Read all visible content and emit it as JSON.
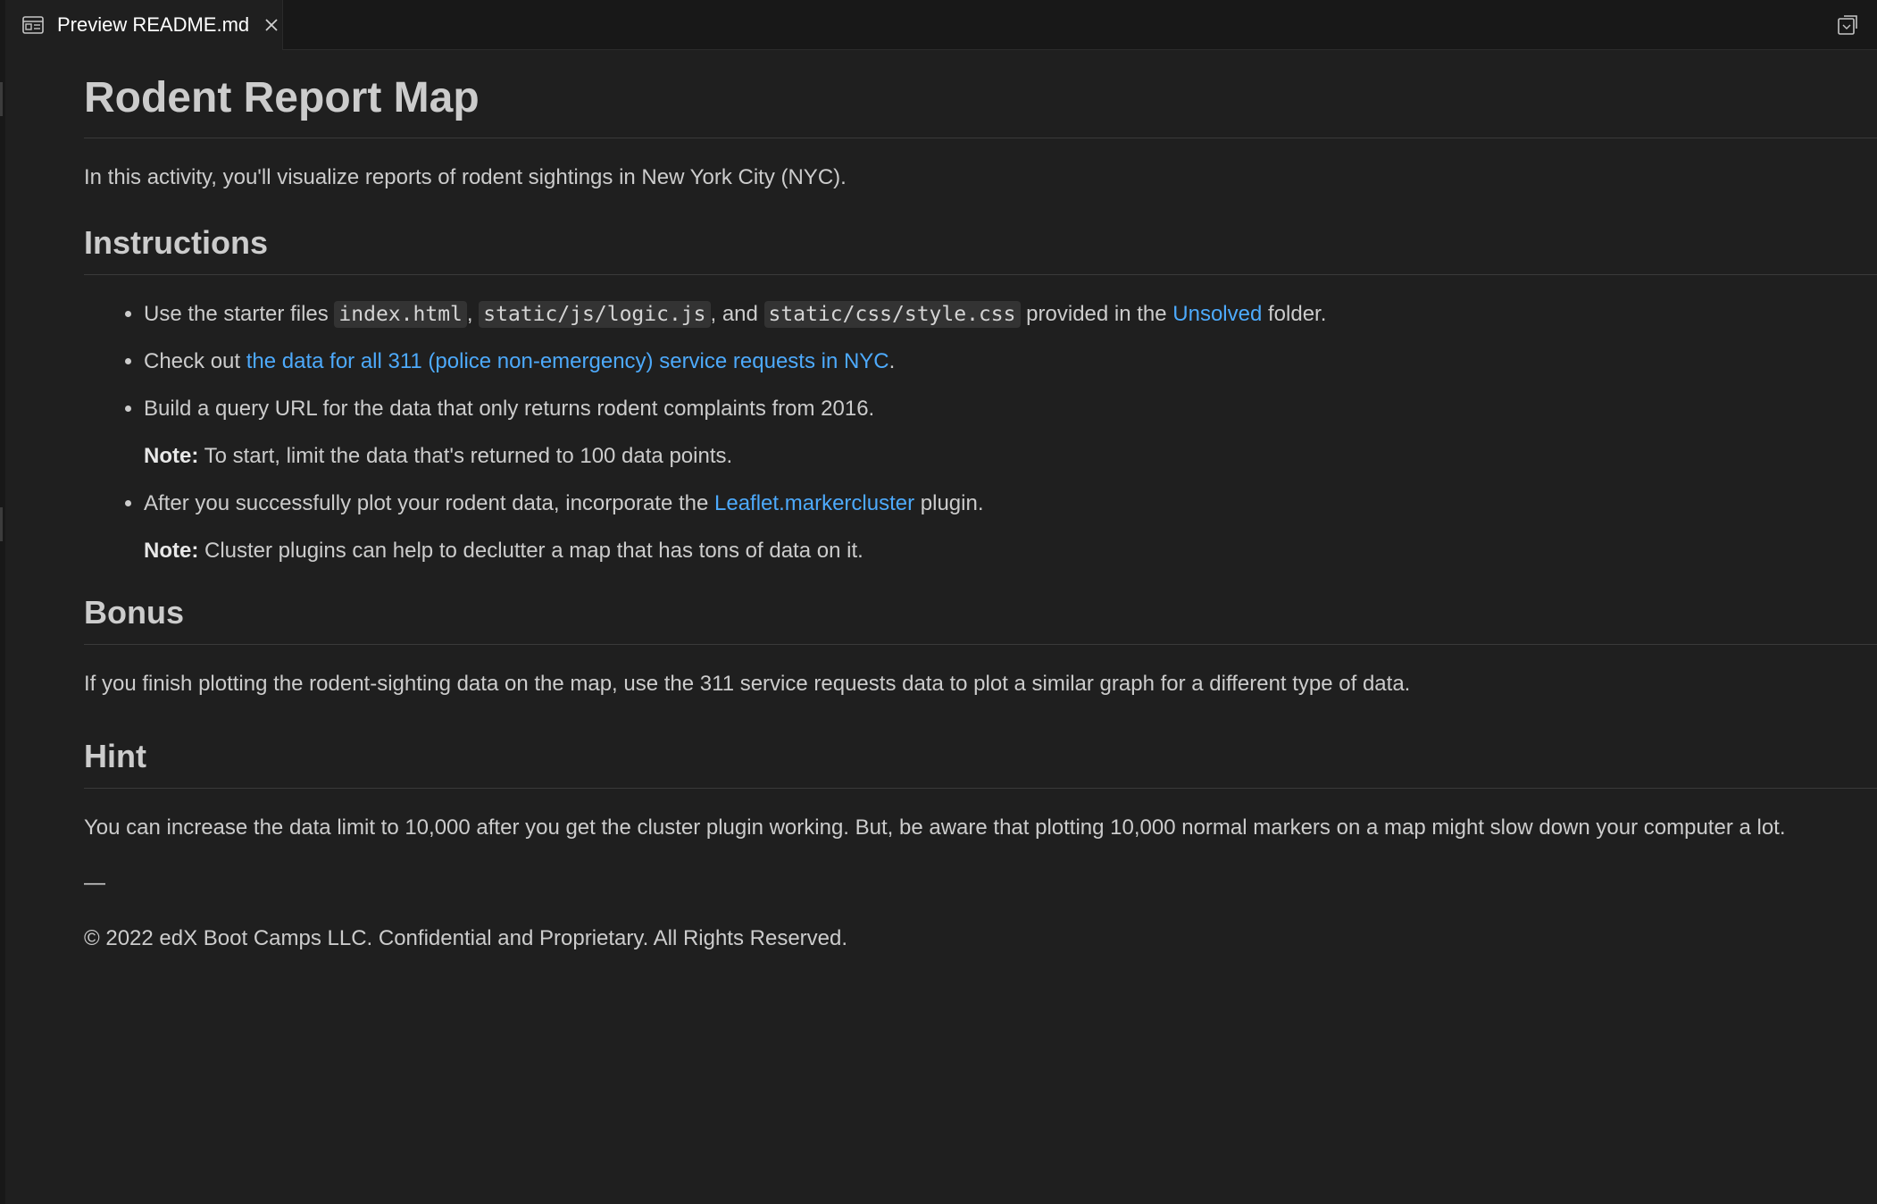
{
  "tab": {
    "label": "Preview README.md",
    "icon": "preview-icon",
    "close_icon": "close-icon",
    "action_icon": "open-source-icon"
  },
  "doc": {
    "title": "Rodent Report Map",
    "intro": "In this activity, you'll visualize reports of rodent sightings in New York City (NYC).",
    "instructions_heading": "Instructions",
    "item1": {
      "prefix": "Use the starter files ",
      "code1": "index.html",
      "sep1": ", ",
      "code2": "static/js/logic.js",
      "sep2": ", and ",
      "code3": "static/css/style.css",
      "middle": " provided in the ",
      "link": "Unsolved",
      "suffix": " folder."
    },
    "item2": {
      "prefix": "Check out ",
      "link": "the data for all 311 (police non-emergency) service requests in NYC",
      "suffix": "."
    },
    "item3": {
      "text": "Build a query URL for the data that only returns rodent complaints from 2016.",
      "note_label": "Note:",
      "note_text": " To start, limit the data that's returned to 100 data points."
    },
    "item4": {
      "prefix": "After you successfully plot your rodent data, incorporate the ",
      "link": "Leaflet.markercluster",
      "suffix": " plugin.",
      "note_label": "Note:",
      "note_text": " Cluster plugins can help to declutter a map that has tons of data on it."
    },
    "bonus_heading": "Bonus",
    "bonus_text": "If you finish plotting the rodent-sighting data on the map, use the 311 service requests data to plot a similar graph for a different type of data.",
    "hint_heading": "Hint",
    "hint_text": "You can increase the data limit to 10,000 after you get the cluster plugin working. But, be aware that plotting 10,000 normal markers on a map might slow down your computer a lot.",
    "dash": "—",
    "copyright": "© 2022 edX Boot Camps LLC. Confidential and Proprietary. All Rights Reserved."
  },
  "colors": {
    "background": "#1f1f1f",
    "tabbar": "#181818",
    "text": "#cccccc",
    "link": "#4daafc",
    "code_bg": "#333333"
  }
}
